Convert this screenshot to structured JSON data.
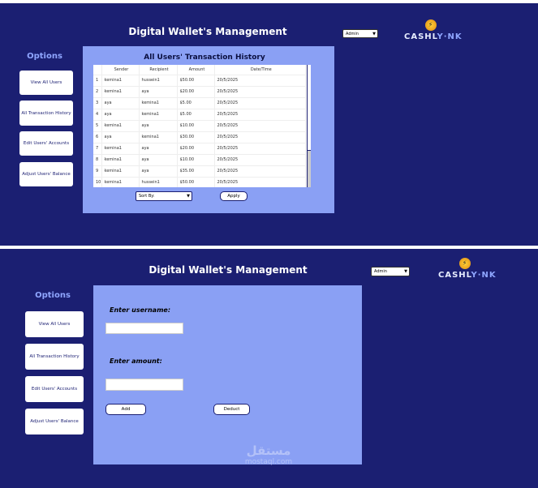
{
  "app_title": "Digital Wallet's Management",
  "options_heading": "Options",
  "nav": [
    "View All Users",
    "All Transaction History",
    "Edit Users' Accounts",
    "Adjust Users' Balance"
  ],
  "role_select": "Admin",
  "logo": {
    "left": "CASHL",
    "right": "Y·NK"
  },
  "history": {
    "title": "All Users' Transaction History",
    "columns": [
      "Sender",
      "Recipient",
      "Amount",
      "Date/Time"
    ],
    "rows": [
      [
        "1",
        "kemina1",
        "hussein1",
        "$50.00",
        "20/5/2025"
      ],
      [
        "2",
        "kemina1",
        "aya",
        "$20.00",
        "20/5/2025"
      ],
      [
        "3",
        "aya",
        "kemina1",
        "$5.00",
        "20/5/2025"
      ],
      [
        "4",
        "aya",
        "kemina1",
        "$5.00",
        "20/5/2025"
      ],
      [
        "5",
        "kemina1",
        "aya",
        "$10.00",
        "20/5/2025"
      ],
      [
        "6",
        "aya",
        "kemina1",
        "$30.00",
        "20/5/2025"
      ],
      [
        "7",
        "kemina1",
        "aya",
        "$20.00",
        "20/5/2025"
      ],
      [
        "8",
        "kemina1",
        "aya",
        "$10.00",
        "20/5/2025"
      ],
      [
        "9",
        "kemina1",
        "aya",
        "$35.00",
        "20/5/2025"
      ],
      [
        "10",
        "kemina1",
        "hussein1",
        "$50.00",
        "20/5/2025"
      ]
    ],
    "sort_select": "Sort By:",
    "apply": "Apply"
  },
  "balance": {
    "username_label": "Enter username:",
    "amount_label": "Enter amount:",
    "username_value": "",
    "amount_value": "",
    "add": "Add",
    "deduct": "Deduct"
  },
  "watermark": {
    "arabic": "مستقل",
    "latin": "mostaql.com"
  }
}
